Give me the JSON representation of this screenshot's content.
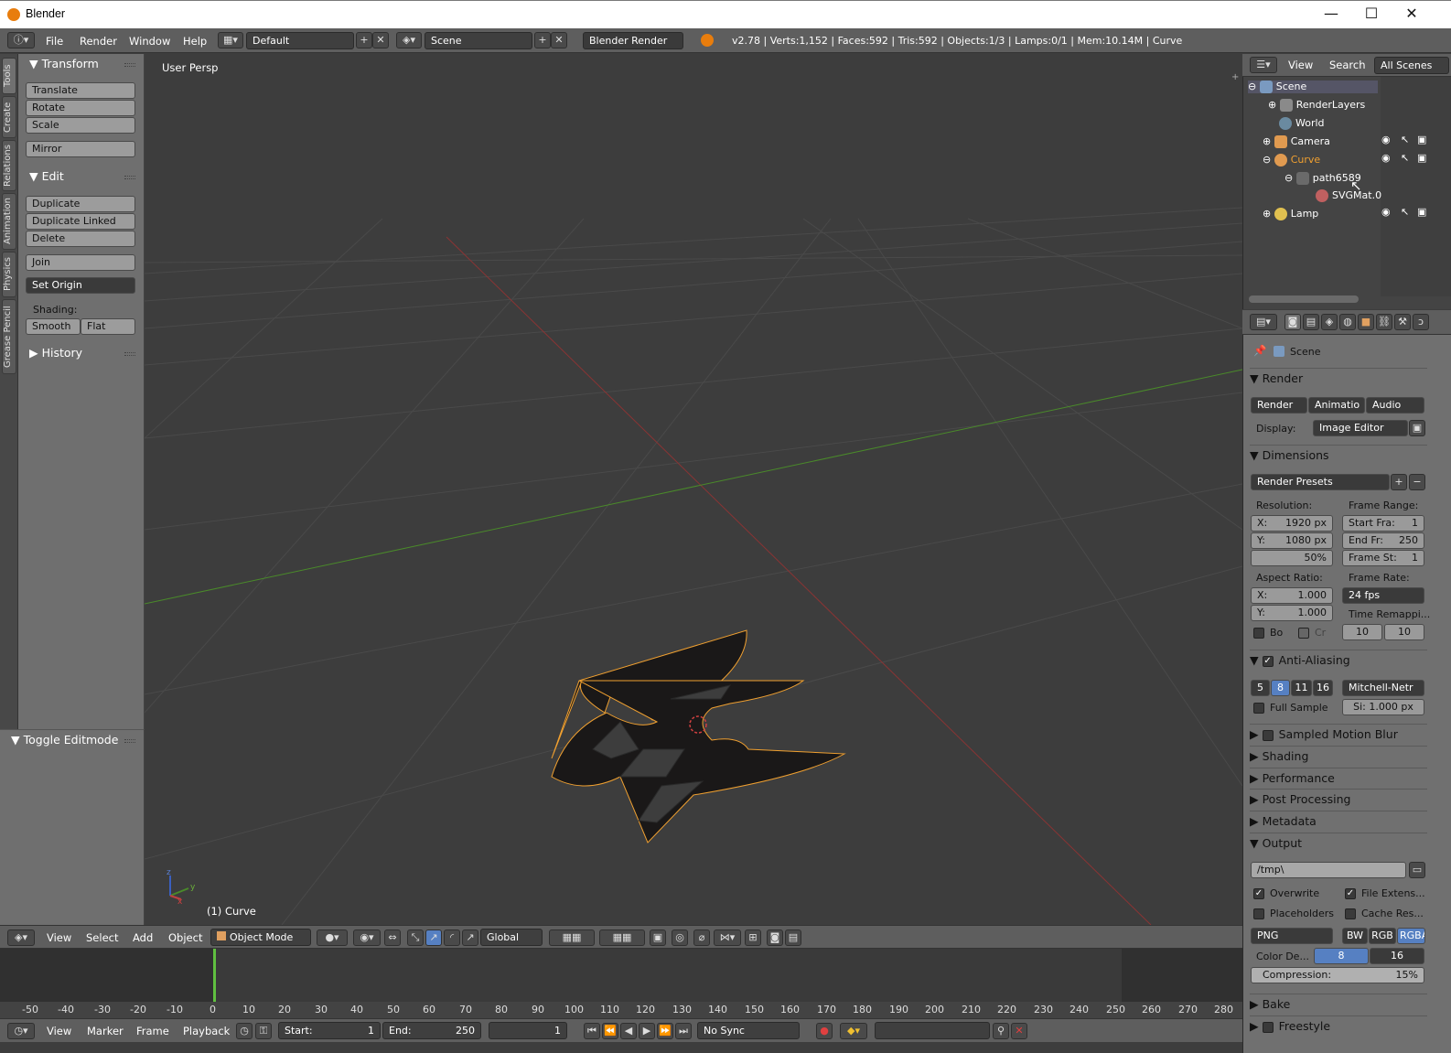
{
  "window": {
    "title": "Blender",
    "minimize": "—",
    "maximize": "☐",
    "close": "✕"
  },
  "topbar": {
    "menus": [
      "File",
      "Render",
      "Window",
      "Help"
    ],
    "layout": "Default",
    "scene": "Scene",
    "engine": "Blender Render",
    "stats": "v2.78 | Verts:1,152 | Faces:592 | Tris:592 | Objects:1/3 | Lamps:0/1 | Mem:10.14M | Curve"
  },
  "tool_tabs": [
    "Tools",
    "Create",
    "Relations",
    "Animation",
    "Physics",
    "Grease Pencil"
  ],
  "toolshelf": {
    "transform_title": "Transform",
    "translate": "Translate",
    "rotate": "Rotate",
    "scale": "Scale",
    "mirror": "Mirror",
    "edit_title": "Edit",
    "duplicate": "Duplicate",
    "duplicate_linked": "Duplicate Linked",
    "delete": "Delete",
    "join": "Join",
    "set_origin": "Set Origin",
    "shading_label": "Shading:",
    "smooth": "Smooth",
    "flat": "Flat",
    "history_title": "History",
    "toggle_editmode": "Toggle Editmode"
  },
  "viewport": {
    "view_label": "User Persp",
    "object_label": "(1) Curve",
    "axis_x": "x",
    "axis_y": "y",
    "axis_z": "z"
  },
  "view_header": {
    "menus": [
      "View",
      "Select",
      "Add",
      "Object"
    ],
    "mode": "Object Mode",
    "orientation": "Global"
  },
  "timeline": {
    "ticks": [
      "-50",
      "-40",
      "-30",
      "-20",
      "-10",
      "0",
      "10",
      "20",
      "30",
      "40",
      "50",
      "60",
      "70",
      "80",
      "90",
      "100",
      "110",
      "120",
      "130",
      "140",
      "150",
      "160",
      "170",
      "180",
      "190",
      "200",
      "210",
      "220",
      "230",
      "240",
      "250",
      "260",
      "270",
      "280"
    ],
    "menus": [
      "View",
      "Marker",
      "Frame",
      "Playback"
    ],
    "start": "Start:",
    "start_val": "1",
    "end": "End:",
    "end_val": "250",
    "current": "1",
    "sync": "No Sync"
  },
  "outliner": {
    "menus": [
      "View",
      "Search"
    ],
    "filter": "All Scenes",
    "items": [
      "Scene",
      "RenderLayers",
      "World",
      "Camera",
      "Curve",
      "path6589",
      "SVGMat.0",
      "Lamp"
    ]
  },
  "properties": {
    "context": "Scene",
    "render_title": "Render",
    "render_btn": "Render",
    "anim_btn": "Animatio",
    "audio_btn": "Audio",
    "display_label": "Display:",
    "display_value": "Image Editor",
    "dimensions_title": "Dimensions",
    "render_presets": "Render Presets",
    "resolution_label": "Resolution:",
    "res_x": "X:",
    "res_x_val": "1920 px",
    "res_y": "Y:",
    "res_y_val": "1080 px",
    "res_pct": "50%",
    "frame_range_label": "Frame Range:",
    "start_fra": "Start Fra:",
    "start_fra_val": "1",
    "end_fr": "End Fr:",
    "end_fr_val": "250",
    "frame_st": "Frame St:",
    "frame_st_val": "1",
    "aspect_label": "Aspect Ratio:",
    "asp_x": "X:",
    "asp_x_val": "1.000",
    "asp_y": "Y:",
    "asp_y_val": "1.000",
    "frame_rate_label": "Frame Rate:",
    "fps": "24 fps",
    "time_remap": "Time Remappi...",
    "remap_old": "10",
    "remap_new": "10",
    "bo": "Bo",
    "cr": "Cr",
    "aa_title": "Anti-Aliasing",
    "aa_5": "5",
    "aa_8": "8",
    "aa_11": "11",
    "aa_16": "16",
    "filter": "Mitchell-Netr",
    "full_sample": "Full Sample",
    "filter_size": "Si: 1.000 px",
    "smb_title": "Sampled Motion Blur",
    "shading_title": "Shading",
    "performance_title": "Performance",
    "post_title": "Post Processing",
    "metadata_title": "Metadata",
    "output_title": "Output",
    "output_path": "/tmp\\",
    "overwrite": "Overwrite",
    "file_ext": "File Extens...",
    "placeholders": "Placeholders",
    "cache_res": "Cache Res...",
    "format": "PNG",
    "bw": "BW",
    "rgb": "RGB",
    "rgba": "RGBA",
    "color_depth": "Color De...",
    "depth_8": "8",
    "depth_16": "16",
    "compression": "Compression:",
    "compression_val": "15%",
    "bake_title": "Bake",
    "freestyle_title": "Freestyle"
  },
  "colors": {
    "accent_blue": "#5680c2",
    "selection_orange": "#f0a030",
    "x_axis": "#9e3a3a",
    "y_axis": "#4c8f2a"
  }
}
